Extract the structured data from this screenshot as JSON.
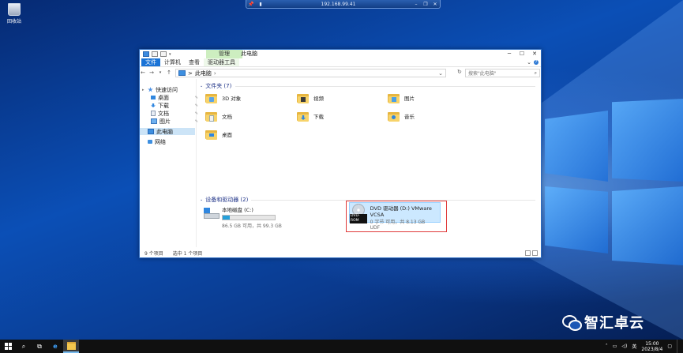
{
  "remote_bar": {
    "host": "192.168.99.41"
  },
  "desktop": {
    "recycle_bin_label": "回收站"
  },
  "window": {
    "title": "此电脑",
    "contextual_tab": "管理",
    "ribbon_tabs": [
      "文件",
      "计算机",
      "查看",
      "驱动器工具"
    ],
    "address": {
      "path": "此电脑",
      "separator": ">"
    },
    "search_placeholder": "搜索\"此电脑\"",
    "nav": {
      "quick_access": "快速访问",
      "quick_items": [
        "桌面",
        "下载",
        "文档",
        "图片"
      ],
      "this_pc": "此电脑",
      "network": "网络"
    },
    "folders_group": "文件夹 (7)",
    "folders": [
      "3D 对象",
      "视频",
      "图片",
      "文档",
      "下载",
      "音乐",
      "桌面"
    ],
    "devices_group": "设备和驱动器 (2)",
    "drive_c": {
      "name": "本地磁盘 (C:)",
      "free": "86.5 GB 可用，共 99.3 GB",
      "used_fraction": 0.13
    },
    "drive_d": {
      "name": "DVD 驱动器 (D:) VMware VCSA",
      "free": "0 字节 可用，共 8.13 GB",
      "fs": "UDF",
      "disc_label": "DVD-ROM"
    },
    "status": {
      "items": "9 个项目",
      "selected": "选中 1 个项目"
    }
  },
  "taskbar": {
    "tray_lang": "英",
    "time": "15:00",
    "date": "2023/8/4"
  },
  "watermark": {
    "text": "智汇卓云"
  },
  "colors": {
    "accent": "#1a73d6",
    "selection": "#cce8ff",
    "highlight_box": "#e03a3a"
  }
}
